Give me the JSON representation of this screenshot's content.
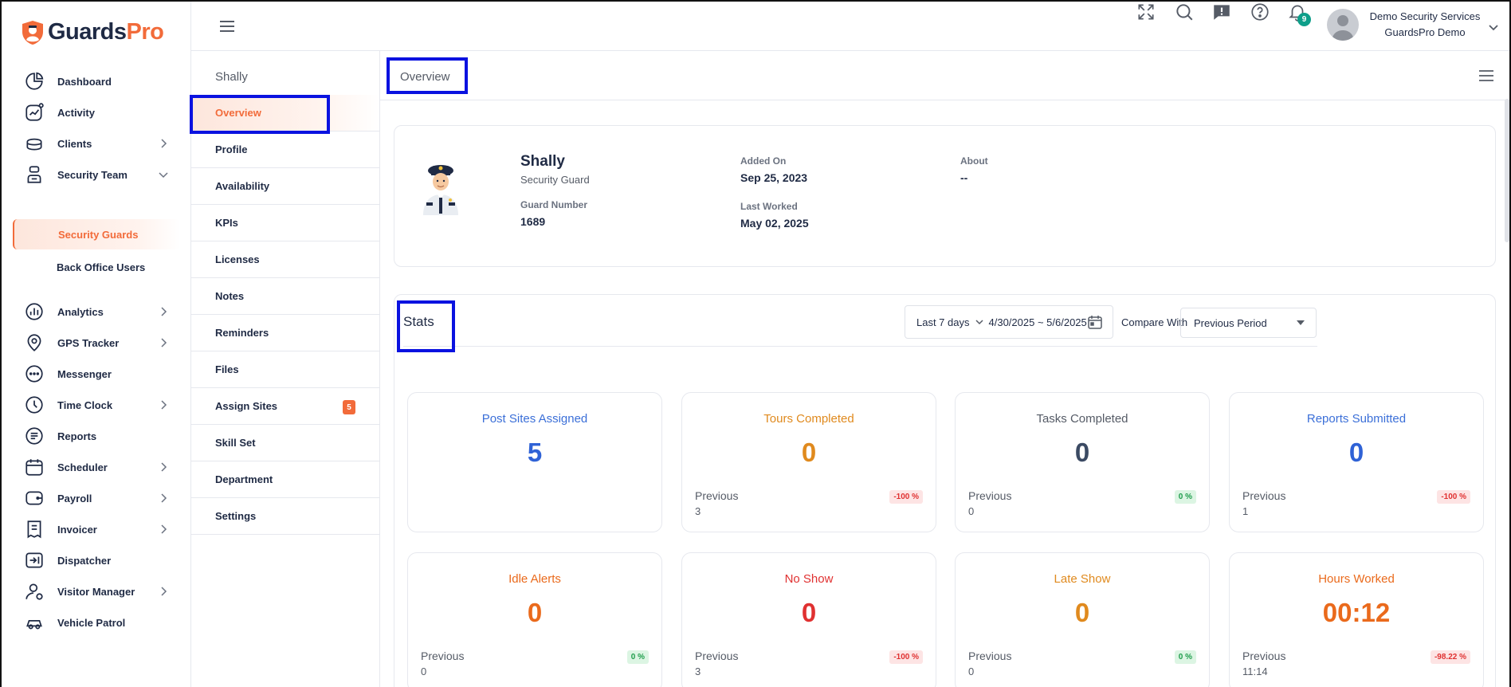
{
  "brand": {
    "name_a": "Guards",
    "name_b": "Pro",
    "colors": {
      "accent": "#f26b3a",
      "navy": "#1f2a44",
      "highlight": "#0a12e0"
    }
  },
  "sidebar": {
    "items": [
      {
        "label": "Dashboard",
        "icon": "pie-chart-icon"
      },
      {
        "label": "Activity",
        "icon": "activity-icon"
      },
      {
        "label": "Clients",
        "icon": "clients-icon"
      },
      {
        "label": "Security Team",
        "icon": "security-team-icon"
      },
      {
        "label": "Security Guards"
      },
      {
        "label": "Back Office Users"
      },
      {
        "label": "Analytics",
        "icon": "analytics-icon"
      },
      {
        "label": "GPS Tracker",
        "icon": "location-pin-icon"
      },
      {
        "label": "Messenger",
        "icon": "chat-bubble-icon"
      },
      {
        "label": "Time Clock",
        "icon": "clock-icon"
      },
      {
        "label": "Reports",
        "icon": "report-icon"
      },
      {
        "label": "Scheduler",
        "icon": "calendar-icon"
      },
      {
        "label": "Payroll",
        "icon": "wallet-icon"
      },
      {
        "label": "Invoicer",
        "icon": "invoice-icon"
      },
      {
        "label": "Dispatcher",
        "icon": "dispatch-icon"
      },
      {
        "label": "Visitor Manager",
        "icon": "visitor-icon"
      },
      {
        "label": "Vehicle Patrol",
        "icon": "vehicle-icon"
      }
    ]
  },
  "topbar": {
    "icons": [
      "fullscreen-icon",
      "search-icon",
      "feedback-icon",
      "help-icon",
      "bell-icon"
    ],
    "notification_count": "9",
    "user_name": "Demo Security Services",
    "user_org": "GuardsPro Demo"
  },
  "subnav": {
    "title": "Shally",
    "items": [
      {
        "label": "Overview"
      },
      {
        "label": "Profile"
      },
      {
        "label": "Availability"
      },
      {
        "label": "KPIs"
      },
      {
        "label": "Licenses"
      },
      {
        "label": "Notes"
      },
      {
        "label": "Reminders"
      },
      {
        "label": "Files"
      },
      {
        "label": "Assign Sites",
        "badge": "5"
      },
      {
        "label": "Skill Set"
      },
      {
        "label": "Department"
      },
      {
        "label": "Settings"
      }
    ]
  },
  "main": {
    "title": "Overview",
    "guard": {
      "name": "Shally",
      "role": "Security Guard",
      "number_label": "Guard Number",
      "number": "1689",
      "added_label": "Added On",
      "added": "Sep 25, 2023",
      "worked_label": "Last Worked",
      "worked": "May 02, 2025",
      "about_label": "About",
      "about": "--"
    },
    "stats": {
      "title": "Stats",
      "range_preset": "Last 7 days",
      "range_dates": "4/30/2025 ~ 5/6/2025",
      "compare_label": "Compare With",
      "compare_value": "Previous Period",
      "previous_label": "Previous",
      "cards": [
        {
          "title": "Post Sites Assigned",
          "value": "5",
          "title_color": "#3b6fd8",
          "value_color": "#2f62d6"
        },
        {
          "title": "Tours Completed",
          "value": "0",
          "previous": "3",
          "change": "-100 %",
          "title_color": "#e08a1e",
          "value_color": "#e08a1e"
        },
        {
          "title": "Tasks Completed",
          "value": "0",
          "previous": "0",
          "change": "0 %",
          "title_color": "#555b66",
          "value_color": "#3b4a63"
        },
        {
          "title": "Reports Submitted",
          "value": "0",
          "previous": "1",
          "change": "-100 %",
          "title_color": "#3b6fd8",
          "value_color": "#2f62d6"
        },
        {
          "title": "Idle Alerts",
          "value": "0",
          "previous": "0",
          "change": "0 %",
          "title_color": "#ea6a1c",
          "value_color": "#ea6a1c"
        },
        {
          "title": "No Show",
          "value": "0",
          "previous": "3",
          "change": "-100 %",
          "title_color": "#e03131",
          "value_color": "#e03131"
        },
        {
          "title": "Late Show",
          "value": "0",
          "previous": "0",
          "change": "0 %",
          "title_color": "#e08a1e",
          "value_color": "#e08a1e"
        },
        {
          "title": "Hours Worked",
          "value": "00:12",
          "previous": "11:14",
          "change": "-98.22 %",
          "title_color": "#ea6a1c",
          "value_color": "#ea6a1c"
        }
      ]
    }
  }
}
